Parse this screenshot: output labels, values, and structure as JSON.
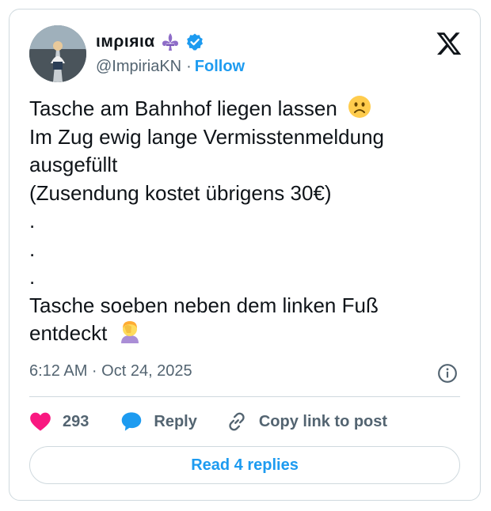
{
  "author": {
    "display_name": "ιмριяια",
    "handle": "@ImpiriaKN",
    "separator": "·",
    "follow_label": "Follow"
  },
  "tweet": {
    "lines": [
      "Tasche am Bahnhof liegen lassen",
      "Im Zug ewig lange Vermisstenmeldung",
      "ausgefüllt",
      "(Zusendung kostet übrigens 30€)",
      ".",
      ".",
      ".",
      "Tasche soeben neben dem linken Fuß",
      "entdeckt"
    ],
    "timestamp": "6:12 AM · Oct 24, 2025"
  },
  "actions": {
    "like_count": "293",
    "reply_label": "Reply",
    "copy_label": "Copy link to post"
  },
  "footer": {
    "read_replies_label": "Read 4 replies"
  },
  "colors": {
    "accent": "#1d9bf0",
    "like": "#f91880",
    "muted": "#536471",
    "border": "#cfd9de"
  },
  "icons": [
    "x-logo-icon",
    "verified-badge-icon",
    "fleur-de-lis-icon",
    "info-icon",
    "heart-icon",
    "reply-bubble-icon",
    "link-icon",
    "frown-emoji-icon",
    "facepalm-emoji-icon"
  ]
}
